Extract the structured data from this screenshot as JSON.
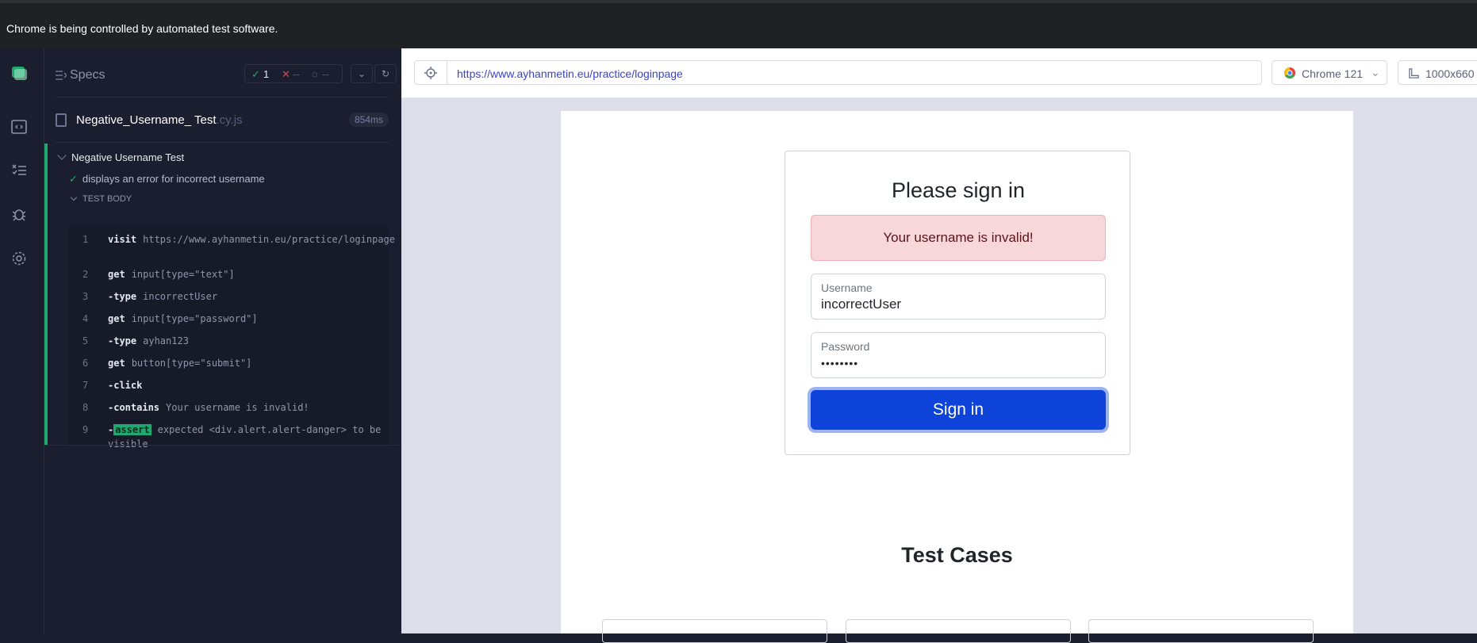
{
  "chrome_banner": "Chrome is being controlled by automated test software.",
  "sidebar": {
    "specs_title": "Specs",
    "passed_count": "1",
    "failed_count": "--",
    "pending_count": "--"
  },
  "spec": {
    "name": "Negative_Username_ Test",
    "ext": ".cy.js",
    "duration": "854ms"
  },
  "suite": {
    "title": "Negative Username Test",
    "test_title": "displays an error for incorrect username",
    "body_label": "TEST BODY",
    "commands": [
      {
        "num": "1",
        "name": "visit",
        "arg": "https://www.ayhanmetin.eu/practice/loginpage"
      },
      {
        "num": "2",
        "name": "get",
        "arg": "input[type=\"text\"]"
      },
      {
        "num": "3",
        "name": "-type",
        "arg": "incorrectUser"
      },
      {
        "num": "4",
        "name": "get",
        "arg": "input[type=\"password\"]"
      },
      {
        "num": "5",
        "name": "-type",
        "arg": "ayhan123"
      },
      {
        "num": "6",
        "name": "get",
        "arg": "button[type=\"submit\"]"
      },
      {
        "num": "7",
        "name": "-click",
        "arg": ""
      },
      {
        "num": "8",
        "name": "-contains",
        "arg": "Your username is invalid!"
      },
      {
        "num": "9",
        "name": "-",
        "badge": "assert",
        "arg": "expected <div.alert.alert-danger> to be visible"
      }
    ]
  },
  "browser": {
    "url": "https://www.ayhanmetin.eu/practice/loginpage",
    "name": "Chrome 121",
    "viewport": "1000x660"
  },
  "app": {
    "heading": "Please sign in",
    "alert": "Your username is invalid!",
    "username_label": "Username",
    "username_value": "incorrectUser",
    "password_label": "Password",
    "password_value": "••••••••",
    "signin_label": "Sign in",
    "test_cases_title": "Test Cases"
  },
  "colors": {
    "pass_green": "#1fa971",
    "signin_blue": "#0d43d8",
    "alert_bg": "#f8d7da"
  }
}
